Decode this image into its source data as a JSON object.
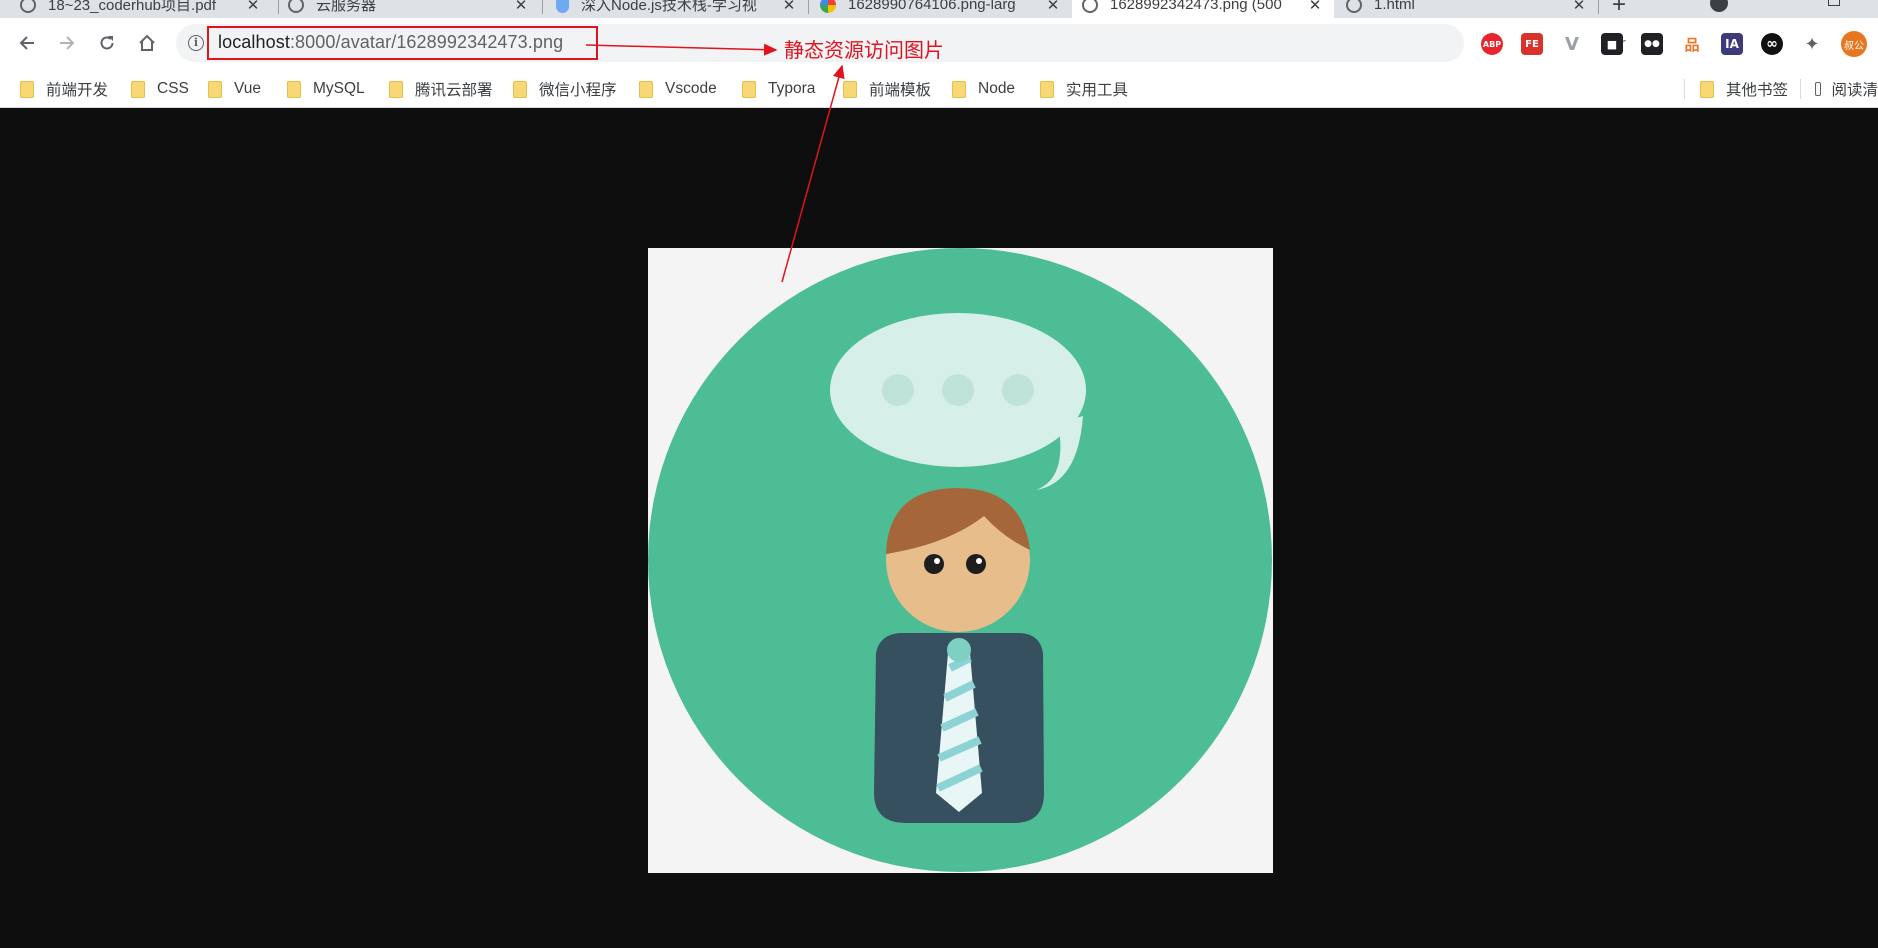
{
  "tabs": [
    {
      "title": "18~23_coderhub项目.pdf",
      "favicon": "globe-icon",
      "active": false
    },
    {
      "title": "云服务器",
      "favicon": "globe-icon",
      "active": false
    },
    {
      "title": "深入Node.js技术栈-学习视",
      "favicon": "shield-icon",
      "active": false
    },
    {
      "title": "1628990764106.png-larg",
      "favicon": "google-icon",
      "active": false
    },
    {
      "title": "1628992342473.png (500",
      "favicon": "globe-icon",
      "active": true
    },
    {
      "title": "1.html",
      "favicon": "globe-icon",
      "active": false
    }
  ],
  "tab_close_glyph": "✕",
  "new_tab_glyph": "+",
  "address": {
    "host": "localhost",
    "rest": ":8000/avatar/1628992342473.png"
  },
  "annotation": {
    "label": "静态资源访问图片",
    "color": "#e0131f"
  },
  "extensions": [
    {
      "name": "adblock-plus-extension-icon",
      "label": "ABP",
      "color": "#e8242c"
    },
    {
      "name": "fe-helper-extension-icon",
      "label": "FE",
      "color": "#d9322b"
    },
    {
      "name": "vue-devtools-extension-icon",
      "label": "V",
      "color": "#9aa0a6"
    },
    {
      "name": "qr-code-extension-icon",
      "label": "■",
      "color": "#202124"
    },
    {
      "name": "tampermonkey-extension-icon",
      "label": "●●",
      "color": "#202124"
    },
    {
      "name": "sitemap-extension-icon",
      "label": "品",
      "color": "#e8762b"
    },
    {
      "name": "ia-extension-icon",
      "label": "IA",
      "color": "#3d3b7a"
    },
    {
      "name": "infinity-extension-icon",
      "label": "∞",
      "color": "#111111"
    },
    {
      "name": "puzzle-extensions-icon",
      "label": "✦",
      "color": "#5f6368"
    }
  ],
  "profile": {
    "label": "叔公",
    "color": "#e8761f"
  },
  "bookmarks": [
    {
      "label": "前端开发"
    },
    {
      "label": "CSS"
    },
    {
      "label": "Vue"
    },
    {
      "label": "MySQL"
    },
    {
      "label": "腾讯云部署"
    },
    {
      "label": "微信小程序"
    },
    {
      "label": "Vscode"
    },
    {
      "label": "Typora"
    },
    {
      "label": "前端模板"
    },
    {
      "label": "Node"
    },
    {
      "label": "实用工具"
    }
  ],
  "other_bookmarks": "其他书签",
  "reading_list": "阅读清",
  "colors": {
    "avatar_circle": "#4dbd95",
    "bubble": "#d6efe9",
    "hair": "#a5673a",
    "face": "#e8bd8c",
    "suit": "#36505f",
    "tie": "#8dd3d6"
  }
}
